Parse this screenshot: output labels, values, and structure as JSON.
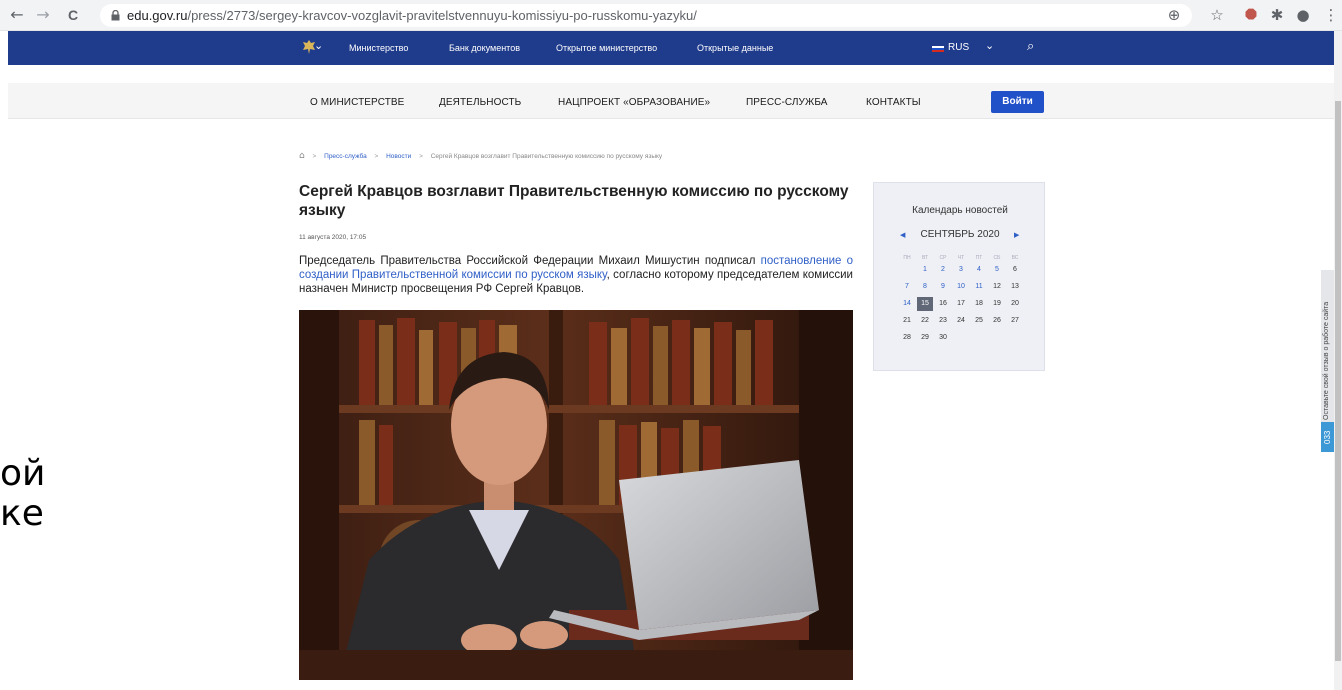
{
  "browser": {
    "back": "←",
    "forward": "→",
    "reload": "C",
    "url_host": "edu.gov.ru",
    "url_path": "/press/2773/sergey-kravcov-vozglavit-pravitelstvennuyu-komissiyu-po-russkomu-yazyku/",
    "zoom_icon": "⊕",
    "star_icon": "☆",
    "ext_icon": "⯃",
    "puzzle_icon": "✱",
    "profile_icon": "●",
    "menu_icon": "⋮"
  },
  "top_bar": {
    "emblem_chevron": "⌄",
    "links": [
      "Министерство",
      "Банк документов",
      "Открытое министерство",
      "Открытые данные"
    ],
    "lang": "RUS",
    "lang_chevron": "⌄",
    "search_icon": "⌕"
  },
  "main_nav": {
    "items": [
      "О МИНИСТЕРСТВЕ",
      "ДЕЯТЕЛЬНОСТЬ",
      "НАЦПРОЕКТ «ОБРАЗОВАНИЕ»",
      "ПРЕСС-СЛУЖБА",
      "КОНТАКТЫ"
    ],
    "login": "Войти"
  },
  "breadcrumb": {
    "home_icon": "⌂",
    "sep": ">",
    "items": [
      "Пресс-служба",
      "Новости",
      "Сергей Кравцов возглавит Правительственную комиссию по русскому языку"
    ]
  },
  "article": {
    "title": "Сергей Кравцов возглавит Правительственную комиссию по русскому языку",
    "date": "11 августа 2020, 17:05",
    "body_before": "Председатель Правительства Российской Федерации Михаил Мишустин подписал ",
    "body_link": "постановление о создании Правительственной комиссии по русском языку",
    "body_after": ", согласно которому председателем комиссии назначен Министр просвещения РФ Сергей Кравцов."
  },
  "calendar": {
    "title": "Календарь новостей",
    "prev": "◀",
    "next": "▶",
    "month": "СЕНТЯБРЬ 2020",
    "weekdays": [
      "ПН",
      "ВТ",
      "СР",
      "ЧТ",
      "ПТ",
      "СБ",
      "ВС"
    ],
    "weeks": [
      [
        "",
        "1",
        "2",
        "3",
        "4",
        "5",
        "6"
      ],
      [
        "7",
        "8",
        "9",
        "10",
        "11",
        "12",
        "13"
      ],
      [
        "14",
        "15",
        "16",
        "17",
        "18",
        "19",
        "20"
      ],
      [
        "21",
        "22",
        "23",
        "24",
        "25",
        "26",
        "27"
      ],
      [
        "28",
        "29",
        "30",
        "",
        "",
        "",
        ""
      ]
    ],
    "today": "15",
    "linked_days": [
      "1",
      "2",
      "3",
      "4",
      "5",
      "7",
      "8",
      "9",
      "10",
      "11",
      "14"
    ]
  },
  "feedback": {
    "text": "Оставьте свой отзыв о работе сайта",
    "count": "033"
  },
  "overlay": {
    "line1": "ой",
    "line2": "ке"
  },
  "colors": {
    "top_bar": "#1f3b8c",
    "login": "#2151c9",
    "link": "#2f5fc7"
  }
}
